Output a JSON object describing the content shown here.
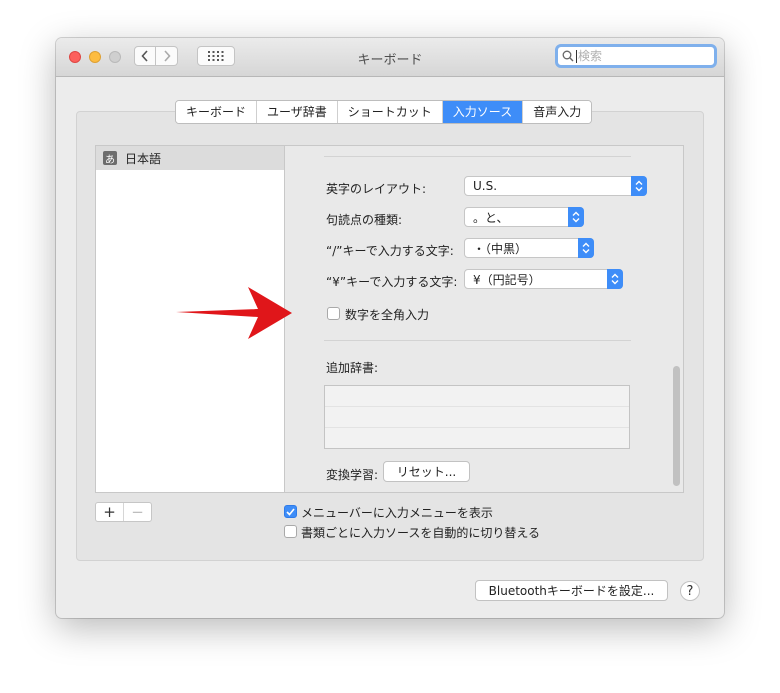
{
  "window": {
    "title": "キーボード",
    "search_placeholder": "検索"
  },
  "tabs": [
    {
      "label": "キーボード",
      "active": false
    },
    {
      "label": "ユーザ辞書",
      "active": false
    },
    {
      "label": "ショートカット",
      "active": false
    },
    {
      "label": "入力ソース",
      "active": true
    },
    {
      "label": "音声入力",
      "active": false
    }
  ],
  "input_sources": [
    {
      "badge": "あ",
      "label": "日本語"
    }
  ],
  "settings": {
    "layout_label": "英字のレイアウト:",
    "layout_value": "U.S.",
    "punct_label": "句読点の種類:",
    "punct_value": "。と、",
    "slash_label": "“/”キーで入力する文字:",
    "slash_value": "・（中黒）",
    "yen_label": "“¥”キーで入力する文字:",
    "yen_value": "¥（円記号）",
    "fullwidth_numbers_label": "数字を全角入力",
    "fullwidth_numbers_checked": false,
    "dict_label": "追加辞書:",
    "learning_label": "変換学習:",
    "reset_button": "リセット..."
  },
  "list_controls": {
    "add": "+",
    "remove": "−"
  },
  "options": {
    "show_menu_label": "メニューバーに入力メニューを表示",
    "show_menu_checked": true,
    "auto_switch_label": "書類ごとに入力ソースを自動的に切り替える",
    "auto_switch_checked": false
  },
  "footer": {
    "bluetooth_button": "Bluetoothキーボードを設定...",
    "help": "?"
  },
  "colors": {
    "accent": "#3e8df8",
    "annotation_arrow": "#e0161a"
  }
}
